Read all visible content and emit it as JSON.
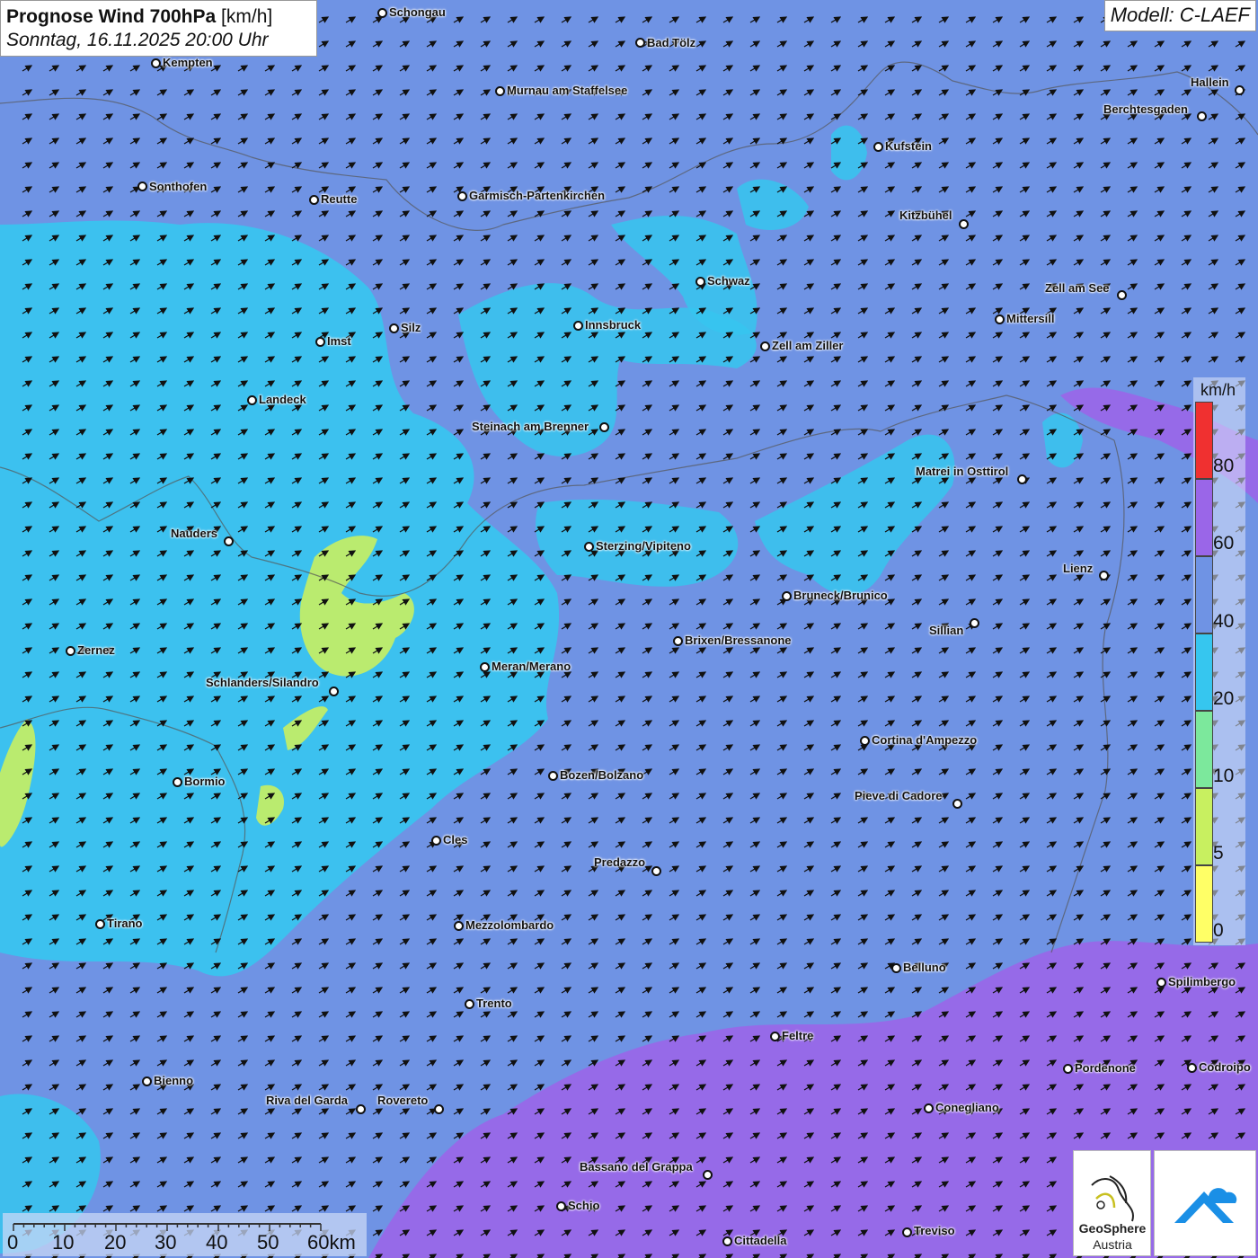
{
  "header": {
    "title_bold": "Prognose Wind 700hPa",
    "title_unit": "[km/h]",
    "datetime": "Sonntag, 16.11.2025 20:00 Uhr",
    "model": "Modell: C-LAEF"
  },
  "legend": {
    "unit": "km/h",
    "ticks": [
      "80",
      "60",
      "40",
      "20",
      "10",
      "5",
      "0"
    ],
    "bands": [
      {
        "color": "#f03030"
      },
      {
        "color": "#9a66e8"
      },
      {
        "color": "#6f93e4"
      },
      {
        "color": "#36c6ef"
      },
      {
        "color": "#7ce89c"
      },
      {
        "color": "#c8f060"
      },
      {
        "color": "#ffff66"
      }
    ]
  },
  "scale_bar": {
    "labels": [
      "0",
      "10",
      "20",
      "30",
      "40",
      "50",
      "60km"
    ]
  },
  "logos": {
    "geosphere_line1": "GeoSphere",
    "geosphere_line2": "Austria"
  },
  "cities": [
    {
      "name": "Schongau"
    },
    {
      "name": "Bad Tölz"
    },
    {
      "name": "Kempten"
    },
    {
      "name": "Murnau am Staffelsee"
    },
    {
      "name": "Hallein"
    },
    {
      "name": "Berchtesgaden"
    },
    {
      "name": "Kufstein"
    },
    {
      "name": "Sonthofen"
    },
    {
      "name": "Reutte"
    },
    {
      "name": "Garmisch-Partenkirchen"
    },
    {
      "name": "Kitzbühel"
    },
    {
      "name": "Schwaz"
    },
    {
      "name": "Zell am See"
    },
    {
      "name": "Innsbruck"
    },
    {
      "name": "Mittersill"
    },
    {
      "name": "Imst"
    },
    {
      "name": "Silz"
    },
    {
      "name": "Zell am Ziller"
    },
    {
      "name": "Landeck"
    },
    {
      "name": "Steinach am Brenner"
    },
    {
      "name": "Matrei in Osttirol"
    },
    {
      "name": "Nauders"
    },
    {
      "name": "Sterzing/Vipiteno"
    },
    {
      "name": "Lienz"
    },
    {
      "name": "Bruneck/Brunico"
    },
    {
      "name": "Sillian"
    },
    {
      "name": "Brixen/Bressanone"
    },
    {
      "name": "Zernez"
    },
    {
      "name": "Meran/Merano"
    },
    {
      "name": "Schlanders/Silandro"
    },
    {
      "name": "Cortina d'Ampezzo"
    },
    {
      "name": "Bozen/Bolzano"
    },
    {
      "name": "Bormio"
    },
    {
      "name": "Pieve di Cadore"
    },
    {
      "name": "Cles"
    },
    {
      "name": "Predazzo"
    },
    {
      "name": "Tirano"
    },
    {
      "name": "Mezzolombardo"
    },
    {
      "name": "Belluno"
    },
    {
      "name": "Spilimbergo"
    },
    {
      "name": "Trento"
    },
    {
      "name": "Feltre"
    },
    {
      "name": "Pordenone"
    },
    {
      "name": "Codroipo"
    },
    {
      "name": "Bienno"
    },
    {
      "name": "Riva del Garda"
    },
    {
      "name": "Rovereto"
    },
    {
      "name": "Conegliano"
    },
    {
      "name": "Bassano del Grappa"
    },
    {
      "name": "Schio"
    },
    {
      "name": "Treviso"
    },
    {
      "name": "Cittadella"
    }
  ]
}
